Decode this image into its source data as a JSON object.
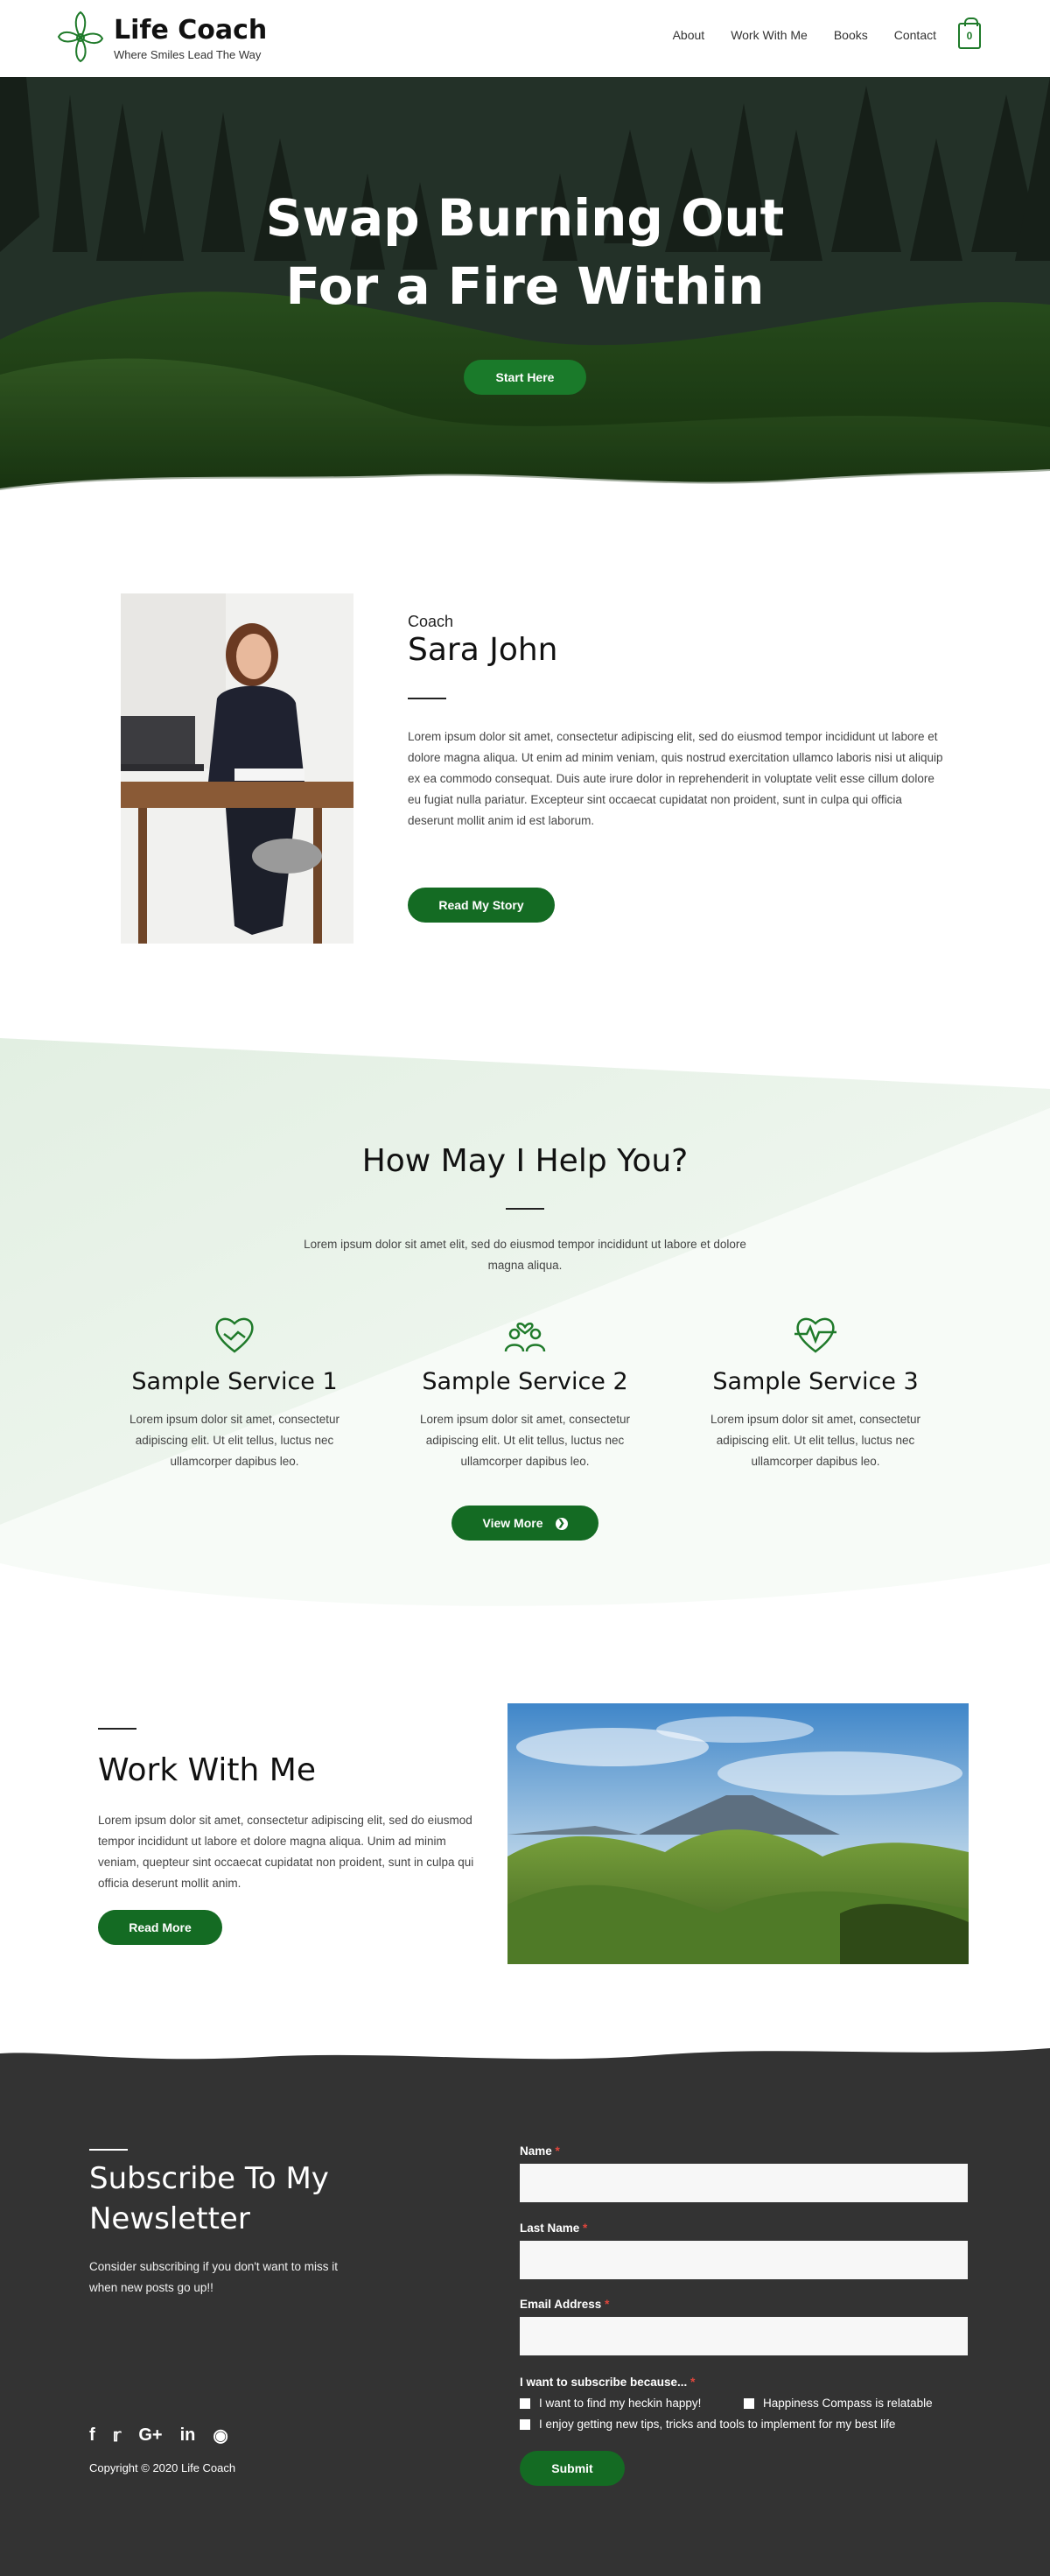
{
  "header": {
    "brand": "Life Coach",
    "tagline": "Where Smiles Lead The Way",
    "nav": [
      "About",
      "Work With Me",
      "Books",
      "Contact"
    ],
    "cart_count": "0"
  },
  "hero": {
    "title_line1": "Swap Burning Out",
    "title_line2": "For a Fire Within",
    "cta": "Start Here"
  },
  "about": {
    "label": "Coach",
    "name": "Sara John",
    "body": "Lorem ipsum dolor sit amet, consectetur adipiscing elit, sed do eiusmod tempor incididunt ut labore et dolore magna aliqua. Ut enim ad minim veniam, quis nostrud exercitation ullamco laboris nisi ut aliquip ex ea commodo consequat. Duis aute irure dolor in reprehenderit in voluptate velit esse cillum dolore eu fugiat nulla pariatur. Excepteur sint occaecat cupidatat non proident, sunt in culpa qui officia deserunt mollit anim id est laborum.",
    "cta": "Read My Story"
  },
  "services": {
    "title": "How May I Help You?",
    "intro": "Lorem ipsum dolor sit amet elit, sed do eiusmod tempor incididunt ut labore et dolore magna aliqua.",
    "items": [
      {
        "icon": "handshake-heart-icon",
        "title": "Sample Service 1",
        "desc": "Lorem ipsum dolor sit amet, consectetur adipiscing elit. Ut elit tellus, luctus nec ullamcorper dapibus leo."
      },
      {
        "icon": "group-heart-icon",
        "title": "Sample Service 2",
        "desc": "Lorem ipsum dolor sit amet, consectetur adipiscing elit. Ut elit tellus, luctus nec ullamcorper dapibus leo."
      },
      {
        "icon": "heartbeat-icon",
        "title": "Sample Service 3",
        "desc": "Lorem ipsum dolor sit amet, consectetur adipiscing elit. Ut elit tellus, luctus nec ullamcorper dapibus leo."
      }
    ],
    "cta": "View More"
  },
  "work": {
    "title": "Work With Me",
    "body": "Lorem ipsum dolor sit amet, consectetur adipiscing elit, sed do eiusmod tempor incididunt ut labore et dolore magna aliqua. Unim ad minim veniam, quepteur sint occaecat cupidatat non proident, sunt in culpa qui officia deserunt mollit anim.",
    "cta": "Read More"
  },
  "newsletter": {
    "title": "Subscribe To My Newsletter",
    "desc": "Consider subscribing if you don't want to miss it when new posts go up!!",
    "fields": {
      "name_label": "Name",
      "last_name_label": "Last Name",
      "email_label": "Email Address",
      "required_mark": "*"
    },
    "subscribe_question": "I want to subscribe because...",
    "options": [
      "I want to find my heckin happy!",
      "Happiness Compass is relatable",
      "I enjoy getting new tips, tricks and tools to implement for my best life"
    ],
    "submit": "Submit",
    "socials": [
      "facebook-icon",
      "twitter-icon",
      "google-plus-icon",
      "linkedin-icon",
      "instagram-icon"
    ],
    "copyright": "Copyright © 2020 Life Coach"
  },
  "colors": {
    "brand_green": "#146b23",
    "footer_bg": "#333333",
    "services_tint": "#e6f1e6"
  }
}
